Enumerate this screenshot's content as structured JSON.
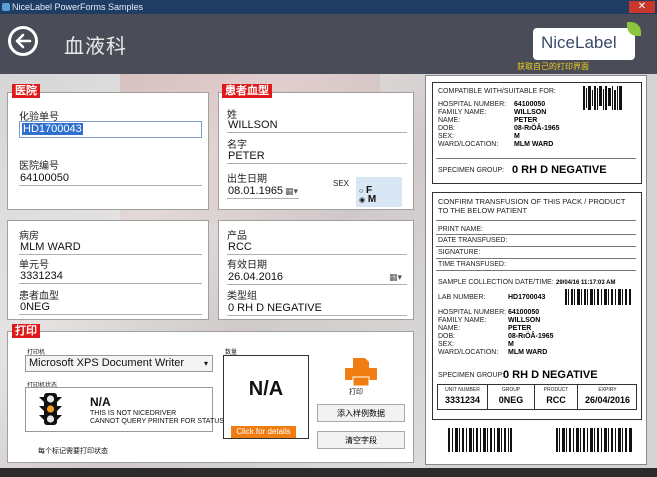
{
  "window": {
    "title": "NiceLabel PowerForms Samples",
    "close": "✕"
  },
  "header": {
    "title": "血液科",
    "logo": "NiceLabel",
    "logo_sub": "获取自己的打印界面"
  },
  "hospital": {
    "section": "医院",
    "test_no_label": "化验单号",
    "test_no_value": "HD1700043",
    "hosp_no_label": "医院编号",
    "hosp_no_value": "64100050"
  },
  "patient": {
    "section": "患者血型",
    "surname_label": "姓",
    "surname_value": "WILLSON",
    "name_label": "名字",
    "name_value": "PETER",
    "dob_label": "出生日期",
    "dob_value": "08.01.1965",
    "sex_label": "SEX",
    "sex_f": "F",
    "sex_m": "M"
  },
  "ward": {
    "ward_label": "病房",
    "ward_value": "MLM WARD",
    "unit_label": "单元号",
    "unit_value": "3331234",
    "blood_label": "患者血型",
    "blood_value": "0NEG"
  },
  "product": {
    "product_label": "产品",
    "product_value": "RCC",
    "expiry_label": "有效日期",
    "expiry_value": "26.04.2016",
    "type_label": "类型组",
    "type_value": "0 RH D NEGATIVE"
  },
  "print": {
    "section": "打印",
    "printer_label": "打印机",
    "printer_value": "Microsoft XPS Document Writer",
    "status_label": "打印机状态",
    "status_value": "N/A",
    "status_msg1": "THIS IS NOT NICEDRIVER",
    "status_msg2": "CANNOT QUERY PRINTER FOR STATUS",
    "queue_text": "每个标记需要打印状态",
    "qty_label": "数量",
    "qty_value": "N/A",
    "details": "Click for details",
    "print_btn": "打印",
    "btn_sample": "添入样例数据",
    "btn_clear": "清空字段"
  },
  "label_preview": {
    "compat": "COMPATIBLE WITH/SUITABLE FOR:",
    "hosp_no_k": "HOSPITAL NUMBER:",
    "hosp_no_v": "64100050",
    "family_k": "FAMILY NAME:",
    "family_v": "WILLSON",
    "name_k": "NAME:",
    "name_v": "PETER",
    "dob_k": "DOB:",
    "dob_v": "08-RıÖÂ-1965",
    "sex_k": "SEX:",
    "sex_v": "M",
    "ward_k": "WARD/LOCATION:",
    "ward_v": "MLM WARD",
    "specgroup_k": "SPECIMEN GROUP:",
    "specgroup_v": "0 RH D NEGATIVE",
    "confirm1": "CONFIRM TRANSFUSION OF THIS PACK / PRODUCT",
    "confirm2": "TO THE BELOW PATIENT",
    "print_name": "PRINT NAME:",
    "date_transfused": "DATE TRANSFUSED:",
    "signature": "SIGNATURE:",
    "time_transfused": "TIME TRANSFUSED:",
    "sample_k": "SAMPLE COLLECTION DATE/TIME:",
    "sample_v": "29/04/16     11:17:03 AM",
    "lab_k": "LAB NUMBER:",
    "lab_v": "HD1700043",
    "hosp2_k": "HOSPITAL NUMBER:",
    "hosp2_v": "64100050",
    "family2_k": "FAMILY NAME:",
    "family2_v": "WILLSON",
    "name2_k": "NAME:",
    "name2_v": "PETER",
    "dob2_k": "DOB:",
    "dob2_v": "08-RıÖÂ-1965",
    "sex2_k": "SEX:",
    "sex2_v": "M",
    "ward2_k": "WARD/LOCATION:",
    "ward2_v": "MLM WARD",
    "spec2_k": "SPECIMEN GROUP:",
    "spec2_v": "0 RH D NEGATIVE",
    "t_unit_h": "UNIT NUMBER",
    "t_unit_v": "3331234",
    "t_group_h": "GROUP",
    "t_group_v": "0NEG",
    "t_product_h": "PRODUCT",
    "t_product_v": "RCC",
    "t_expiry_h": "EXPIRY",
    "t_expiry_v": "26/04/2016"
  },
  "colors": {
    "accent": "#e01a1a",
    "header_bg": "#4a4c57",
    "printer_icon": "#f07d12"
  }
}
